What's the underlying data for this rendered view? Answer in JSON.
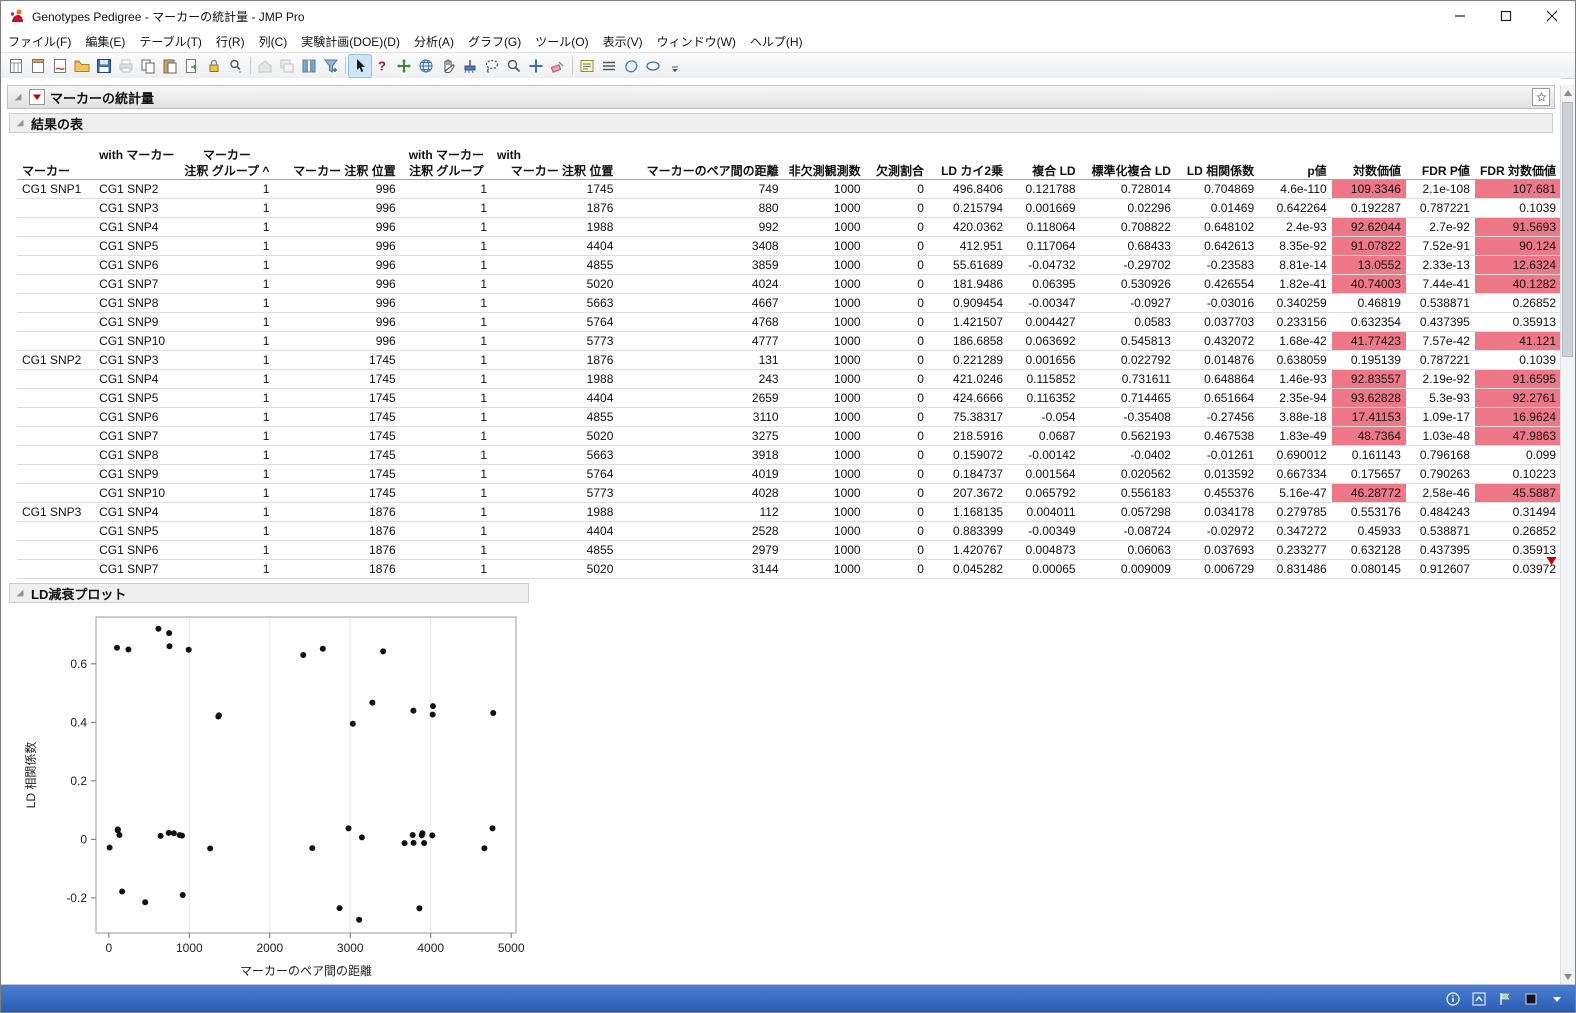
{
  "window": {
    "title": "Genotypes Pedigree - マーカーの統計量 - JMP Pro"
  },
  "menu": {
    "items": [
      "ファイル(F)",
      "編集(E)",
      "テーブル(T)",
      "行(R)",
      "列(C)",
      "実験計画(DOE)(D)",
      "分析(A)",
      "グラフ(G)",
      "ツール(O)",
      "表示(V)",
      "ウィンドウ(W)",
      "ヘルプ(H)"
    ]
  },
  "toolbar": {
    "icon_names": [
      "new-data-table-icon",
      "new-journal-icon",
      "new-script-icon",
      "open-icon",
      "save-icon",
      "print-icon",
      "copy-icon",
      "paste-icon",
      "export-icon",
      "lock-icon",
      "search-icon",
      "home-icon",
      "window-list-icon",
      "column-switcher-icon",
      "data-filter-icon",
      "arrow-tool-icon",
      "help-tool-icon",
      "mover-tool-icon",
      "globe-tool-icon",
      "grabber-tool-icon",
      "brush-tool-icon",
      "lasso-tool-icon",
      "magnifier-tool-icon",
      "crosshair-tool-icon",
      "eraser-tool-icon",
      "annotate-tool-icon",
      "lines-tool-icon",
      "polygon-tool-icon",
      "oval-tool-icon",
      "toolbar-overflow-icon"
    ],
    "selected_tool": "arrow-tool"
  },
  "report": {
    "title": "マーカーの統計量"
  },
  "results": {
    "title": "結果の表",
    "columns": [
      {
        "w": 78,
        "l1": "",
        "l2": "マーカー",
        "a": "left",
        "a1": "left",
        "a2": "left"
      },
      {
        "w": 80,
        "l1": "with マーカー",
        "l2": "",
        "a": "left",
        "a1": "left",
        "a2": "left"
      },
      {
        "w": 84,
        "l1": "マーカー",
        "l2": "注釈 グループ ^",
        "a": "right",
        "a1": "center",
        "a2": "center"
      },
      {
        "w": 128,
        "l1": "",
        "l2": "マーカー 注釈 位置",
        "a": "right",
        "a1": "right",
        "a2": "right"
      },
      {
        "w": 92,
        "l1": "with マーカー",
        "l2": "注釈 グループ",
        "a": "right",
        "a1": "center",
        "a2": "center"
      },
      {
        "w": 128,
        "l1": "with",
        "l2": "マーカー 注釈 位置",
        "a": "right",
        "a1": "left",
        "a2": "right"
      },
      {
        "w": 168,
        "l1": "",
        "l2": "マーカーのペア間の距離",
        "a": "right",
        "a1": "right",
        "a2": "right"
      },
      {
        "w": 76,
        "l1": "",
        "l2": "非欠測観測数",
        "a": "right",
        "a1": "right",
        "a2": "right"
      },
      {
        "w": 64,
        "l1": "",
        "l2": "欠測割合",
        "a": "right",
        "a1": "right",
        "a2": "right"
      },
      {
        "w": 80,
        "l1": "",
        "l2": "LD カイ2乗",
        "a": "right",
        "a1": "right",
        "a2": "right"
      },
      {
        "w": 74,
        "l1": "",
        "l2": "複合 LD",
        "a": "right",
        "a1": "right",
        "a2": "right"
      },
      {
        "w": 96,
        "l1": "",
        "l2": "標準化複合 LD",
        "a": "right",
        "a1": "right",
        "a2": "right"
      },
      {
        "w": 84,
        "l1": "",
        "l2": "LD 相関係数",
        "a": "right",
        "a1": "right",
        "a2": "right"
      },
      {
        "w": 74,
        "l1": "",
        "l2": "p値",
        "a": "right",
        "a1": "right",
        "a2": "right"
      },
      {
        "w": 76,
        "l1": "",
        "l2": "対数価値",
        "a": "right",
        "a1": "right",
        "a2": "right"
      },
      {
        "w": 70,
        "l1": "",
        "l2": "FDR P値",
        "a": "right",
        "a1": "right",
        "a2": "right"
      },
      {
        "w": 84,
        "l1": "",
        "l2": "FDR 対数価値",
        "a": "right",
        "a1": "right",
        "a2": "right"
      }
    ],
    "rows": [
      {
        "c": [
          "CG1 SNP1",
          "CG1 SNP2",
          "1",
          "996",
          "1",
          "1745",
          "749",
          "1000",
          "0",
          "496.8406",
          "0.121788",
          "0.728014",
          "0.704869",
          "4.6e-110",
          "109.3346",
          "2.1e-108",
          "107.681"
        ],
        "hl": true
      },
      {
        "c": [
          "",
          "CG1 SNP3",
          "1",
          "996",
          "1",
          "1876",
          "880",
          "1000",
          "0",
          "0.215794",
          "0.001669",
          "0.02296",
          "0.01469",
          "0.642264",
          "0.192287",
          "0.787221",
          "0.1039"
        ],
        "hl": false
      },
      {
        "c": [
          "",
          "CG1 SNP4",
          "1",
          "996",
          "1",
          "1988",
          "992",
          "1000",
          "0",
          "420.0362",
          "0.118064",
          "0.708822",
          "0.648102",
          "2.4e-93",
          "92.62044",
          "2.7e-92",
          "91.5693"
        ],
        "hl": true
      },
      {
        "c": [
          "",
          "CG1 SNP5",
          "1",
          "996",
          "1",
          "4404",
          "3408",
          "1000",
          "0",
          "412.951",
          "0.117064",
          "0.68433",
          "0.642613",
          "8.35e-92",
          "91.07822",
          "7.52e-91",
          "90.124"
        ],
        "hl": true
      },
      {
        "c": [
          "",
          "CG1 SNP6",
          "1",
          "996",
          "1",
          "4855",
          "3859",
          "1000",
          "0",
          "55.61689",
          "-0.04732",
          "-0.29702",
          "-0.23583",
          "8.81e-14",
          "13.0552",
          "2.33e-13",
          "12.6324"
        ],
        "hl": true
      },
      {
        "c": [
          "",
          "CG1 SNP7",
          "1",
          "996",
          "1",
          "5020",
          "4024",
          "1000",
          "0",
          "181.9486",
          "0.06395",
          "0.530926",
          "0.426554",
          "1.82e-41",
          "40.74003",
          "7.44e-41",
          "40.1282"
        ],
        "hl": true
      },
      {
        "c": [
          "",
          "CG1 SNP8",
          "1",
          "996",
          "1",
          "5663",
          "4667",
          "1000",
          "0",
          "0.909454",
          "-0.00347",
          "-0.0927",
          "-0.03016",
          "0.340259",
          "0.46819",
          "0.538871",
          "0.26852"
        ],
        "hl": false
      },
      {
        "c": [
          "",
          "CG1 SNP9",
          "1",
          "996",
          "1",
          "5764",
          "4768",
          "1000",
          "0",
          "1.421507",
          "0.004427",
          "0.0583",
          "0.037703",
          "0.233156",
          "0.632354",
          "0.437395",
          "0.35913"
        ],
        "hl": false
      },
      {
        "c": [
          "",
          "CG1 SNP10",
          "1",
          "996",
          "1",
          "5773",
          "4777",
          "1000",
          "0",
          "186.6858",
          "0.063692",
          "0.545813",
          "0.432072",
          "1.68e-42",
          "41.77423",
          "7.57e-42",
          "41.121"
        ],
        "hl": true
      },
      {
        "c": [
          "CG1 SNP2",
          "CG1 SNP3",
          "1",
          "1745",
          "1",
          "1876",
          "131",
          "1000",
          "0",
          "0.221289",
          "0.001656",
          "0.022792",
          "0.014876",
          "0.638059",
          "0.195139",
          "0.787221",
          "0.1039"
        ],
        "hl": false
      },
      {
        "c": [
          "",
          "CG1 SNP4",
          "1",
          "1745",
          "1",
          "1988",
          "243",
          "1000",
          "0",
          "421.0246",
          "0.115852",
          "0.731611",
          "0.648864",
          "1.46e-93",
          "92.83557",
          "2.19e-92",
          "91.6595"
        ],
        "hl": true
      },
      {
        "c": [
          "",
          "CG1 SNP5",
          "1",
          "1745",
          "1",
          "4404",
          "2659",
          "1000",
          "0",
          "424.6666",
          "0.116352",
          "0.714465",
          "0.651664",
          "2.35e-94",
          "93.62828",
          "5.3e-93",
          "92.2761"
        ],
        "hl": true
      },
      {
        "c": [
          "",
          "CG1 SNP6",
          "1",
          "1745",
          "1",
          "4855",
          "3110",
          "1000",
          "0",
          "75.38317",
          "-0.054",
          "-0.35408",
          "-0.27456",
          "3.88e-18",
          "17.41153",
          "1.09e-17",
          "16.9624"
        ],
        "hl": true
      },
      {
        "c": [
          "",
          "CG1 SNP7",
          "1",
          "1745",
          "1",
          "5020",
          "3275",
          "1000",
          "0",
          "218.5916",
          "0.0687",
          "0.562193",
          "0.467538",
          "1.83e-49",
          "48.7364",
          "1.03e-48",
          "47.9863"
        ],
        "hl": true
      },
      {
        "c": [
          "",
          "CG1 SNP8",
          "1",
          "1745",
          "1",
          "5663",
          "3918",
          "1000",
          "0",
          "0.159072",
          "-0.00142",
          "-0.0402",
          "-0.01261",
          "0.690012",
          "0.161143",
          "0.796168",
          "0.099"
        ],
        "hl": false
      },
      {
        "c": [
          "",
          "CG1 SNP9",
          "1",
          "1745",
          "1",
          "5764",
          "4019",
          "1000",
          "0",
          "0.184737",
          "0.001564",
          "0.020562",
          "0.013592",
          "0.667334",
          "0.175657",
          "0.790263",
          "0.10223"
        ],
        "hl": false
      },
      {
        "c": [
          "",
          "CG1 SNP10",
          "1",
          "1745",
          "1",
          "5773",
          "4028",
          "1000",
          "0",
          "207.3672",
          "0.065792",
          "0.556183",
          "0.455376",
          "5.16e-47",
          "46.28772",
          "2.58e-46",
          "45.5887"
        ],
        "hl": true
      },
      {
        "c": [
          "CG1 SNP3",
          "CG1 SNP4",
          "1",
          "1876",
          "1",
          "1988",
          "112",
          "1000",
          "0",
          "1.168135",
          "0.004011",
          "0.057298",
          "0.034178",
          "0.279785",
          "0.553176",
          "0.484243",
          "0.31494"
        ],
        "hl": false
      },
      {
        "c": [
          "",
          "CG1 SNP5",
          "1",
          "1876",
          "1",
          "4404",
          "2528",
          "1000",
          "0",
          "0.883399",
          "-0.00349",
          "-0.08724",
          "-0.02972",
          "0.347272",
          "0.45933",
          "0.538871",
          "0.26852"
        ],
        "hl": false
      },
      {
        "c": [
          "",
          "CG1 SNP6",
          "1",
          "1876",
          "1",
          "4855",
          "2979",
          "1000",
          "0",
          "1.420767",
          "0.004873",
          "0.06063",
          "0.037693",
          "0.233277",
          "0.632128",
          "0.437395",
          "0.35913"
        ],
        "hl": false
      },
      {
        "c": [
          "",
          "CG1 SNP7",
          "1",
          "1876",
          "1",
          "5020",
          "3144",
          "1000",
          "0",
          "0.045282",
          "0.00065",
          "0.009009",
          "0.006729",
          "0.831486",
          "0.080145",
          "0.912607",
          "0.03972"
        ],
        "hl": false
      }
    ]
  },
  "plot": {
    "title": "LD減衰プロット"
  },
  "chart_data": {
    "type": "scatter",
    "title": "LD減衰プロット",
    "xlabel": "マーカーのペア間の距離",
    "ylabel": "LD 相関係数",
    "xlim": [
      -160,
      5060
    ],
    "ylim": [
      -0.32,
      0.76
    ],
    "xticks": [
      0,
      1000,
      2000,
      3000,
      4000,
      5000
    ],
    "yticks": [
      -0.2,
      0,
      0.2,
      0.4,
      0.6
    ],
    "grid": "vertical-only",
    "point_color": "#111111",
    "points": [
      [
        749,
        0.704869
      ],
      [
        880,
        0.01469
      ],
      [
        992,
        0.648102
      ],
      [
        3408,
        0.642613
      ],
      [
        3859,
        -0.23583
      ],
      [
        4024,
        0.426554
      ],
      [
        4667,
        -0.03016
      ],
      [
        4768,
        0.037703
      ],
      [
        4777,
        0.432072
      ],
      [
        131,
        0.014876
      ],
      [
        243,
        0.648864
      ],
      [
        2659,
        0.651664
      ],
      [
        3110,
        -0.27456
      ],
      [
        3275,
        0.467538
      ],
      [
        3918,
        -0.01261
      ],
      [
        4019,
        0.013592
      ],
      [
        4028,
        0.455376
      ],
      [
        112,
        0.034178
      ],
      [
        2528,
        -0.02972
      ],
      [
        2979,
        0.037693
      ],
      [
        3144,
        0.006729
      ],
      [
        3787,
        -0.012
      ],
      [
        3888,
        0.014
      ],
      [
        3897,
        0.021
      ],
      [
        2416,
        0.63
      ],
      [
        2867,
        -0.235
      ],
      [
        3032,
        0.395
      ],
      [
        3675,
        -0.013
      ],
      [
        3776,
        0.015
      ],
      [
        3785,
        0.44
      ],
      [
        451,
        -0.215
      ],
      [
        616,
        0.72
      ],
      [
        1259,
        -0.031
      ],
      [
        1360,
        0.42
      ],
      [
        1369,
        0.424
      ],
      [
        165,
        -0.178
      ],
      [
        808,
        0.021
      ],
      [
        909,
        0.013
      ],
      [
        918,
        -0.19
      ],
      [
        643,
        0.012
      ],
      [
        744,
        0.022
      ],
      [
        753,
        0.66
      ],
      [
        101,
        0.655
      ],
      [
        110,
        0.031
      ],
      [
        9,
        -0.028
      ]
    ]
  },
  "statusbar": {
    "icon_names": [
      "info-icon",
      "panel-up-icon",
      "flag-icon",
      "square-icon",
      "statusbar-menu-icon"
    ]
  },
  "colors": {
    "highlight": "#ee7788",
    "statusbar_blue": "#2e68c4",
    "selected_tool_bg": "#cde6f9",
    "point_color": "#111111"
  }
}
